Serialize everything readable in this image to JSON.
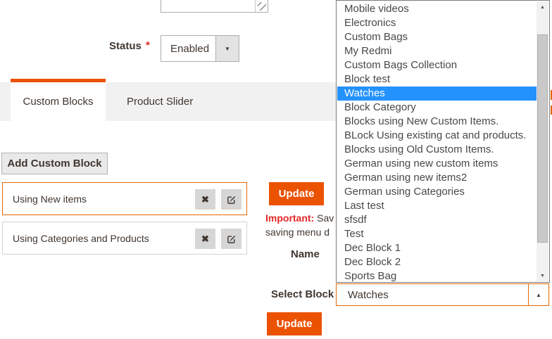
{
  "status_field": {
    "label": "Status",
    "required_mark": "*",
    "value": "Enabled"
  },
  "tabs": {
    "custom_blocks": "Custom Blocks",
    "product_slider": "Product Slider"
  },
  "blocks_panel": {
    "add_button": "Add Custom Block",
    "items": [
      {
        "label": "Using New items",
        "selected": true
      },
      {
        "label": "Using Categories and Products",
        "selected": false
      }
    ],
    "update_button": "Update",
    "note": {
      "prefix": "Important:",
      "line1_rest": " Sav",
      "line2": "saving menu d"
    },
    "name_label": "Name",
    "select_block_label": "Select Block",
    "select_block_value": "Watches",
    "bottom_update_button": "Update"
  },
  "block_dropdown": {
    "options": [
      "Mobile videos",
      "Electronics",
      "Custom Bags",
      "My Redmi",
      "Custom Bags Collection",
      "Block test",
      "Watches",
      "Block Category",
      "Blocks using New Custom Items.",
      "BLock Using existing cat and products.",
      "Blocks using Old Custom Items.",
      "German using new custom items",
      "German using new items2",
      "German using Categories",
      "Last test",
      "sfsdf",
      "Test",
      "Dec Block 1",
      "Dec Block 2",
      "Sports Bag"
    ],
    "highlighted_index": 6,
    "highlighted_option": "Watches"
  },
  "icons": {
    "select_down": "▼",
    "select_up": "▲",
    "scroll_up": "▲",
    "scroll_down": "▼",
    "delete_x": "✖"
  },
  "colors": {
    "accent_orange": "#eb5202",
    "focus_orange": "#e26703",
    "highlight_blue": "#2492fc",
    "error_red": "#e22626"
  }
}
